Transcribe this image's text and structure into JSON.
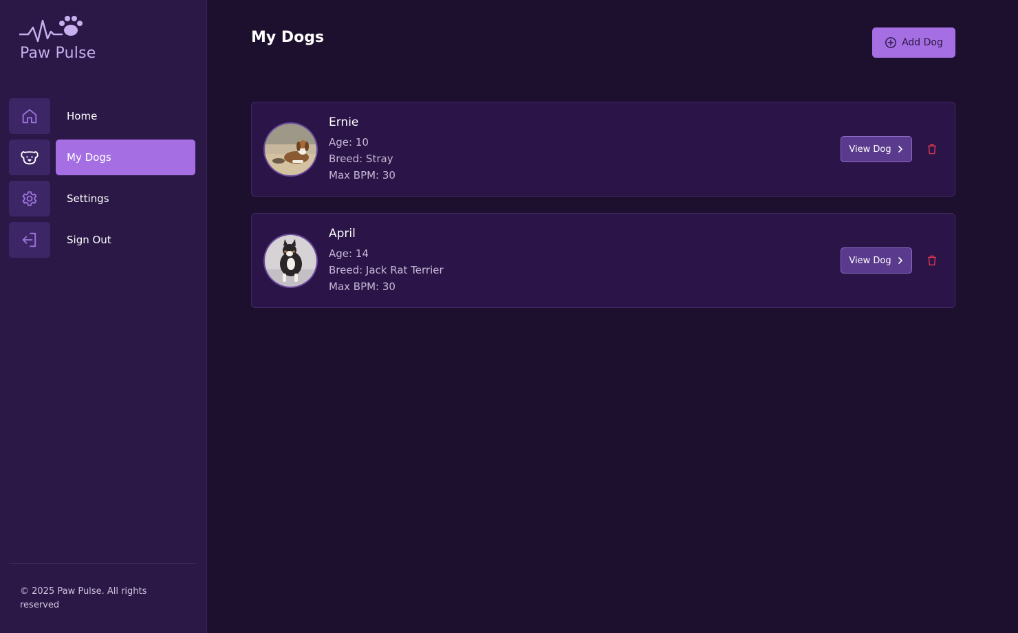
{
  "app": {
    "name": "Paw Pulse"
  },
  "sidebar": {
    "items": [
      {
        "label": "Home",
        "icon": "home-icon"
      },
      {
        "label": "My Dogs",
        "icon": "dog-face-icon",
        "active": true
      },
      {
        "label": "Settings",
        "icon": "gear-icon"
      },
      {
        "label": "Sign Out",
        "icon": "sign-out-icon"
      }
    ],
    "footer": "© 2025 Paw Pulse. All rights reserved"
  },
  "main": {
    "title": "My Dogs",
    "add_button": "Add Dog",
    "dogs": [
      {
        "name": "Ernie",
        "age": "Age: 10",
        "breed": "Breed: Stray",
        "max_bpm": "Max BPM: 30",
        "view_label": "View Dog"
      },
      {
        "name": "April",
        "age": "Age: 14",
        "breed": "Breed: Jack Rat Terrier",
        "max_bpm": "Max BPM: 30",
        "view_label": "View Dog"
      }
    ]
  },
  "colors": {
    "background": "#1d0f2e",
    "sidebar": "#2b1846",
    "accent": "#a56fe3",
    "card": "#2b1548",
    "delete": "#d9364f"
  }
}
